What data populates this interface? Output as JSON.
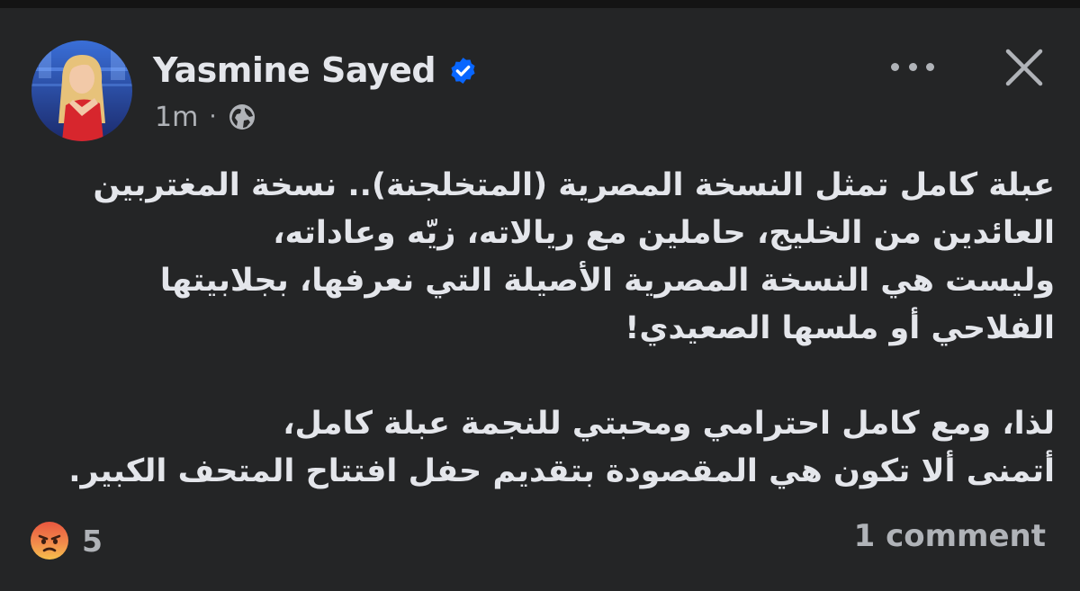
{
  "post": {
    "author": "Yasmine Sayed",
    "verified": true,
    "time": "1m",
    "separator": "·",
    "audience_icon": "globe-icon",
    "body_lines": [
      "عبلة كامل تمثل النسخة المصرية (المتخلجنة).. نسخة المغتربين",
      "العائدين من الخليج، حاملين مع ريالاته، زيّه وعاداته،",
      "وليست هي النسخة المصرية الأصيلة التي نعرفها، بجلابيتها",
      "الفلاحي أو ملسها الصعيدي!",
      "",
      "لذا، ومع كامل احترامي ومحبتي للنجمة عبلة كامل،",
      "أتمنى ألا تكون هي المقصودة بتقديم حفل افتتاح المتحف الكبير."
    ]
  },
  "footer": {
    "reaction_icon": "angry-reaction-icon",
    "reaction_count": "5",
    "comments_label": "1 comment"
  },
  "colors": {
    "background": "#242526",
    "text": "#e4e6eb",
    "secondary_text": "#b0b3b8",
    "verified_blue": "#0866ff"
  }
}
